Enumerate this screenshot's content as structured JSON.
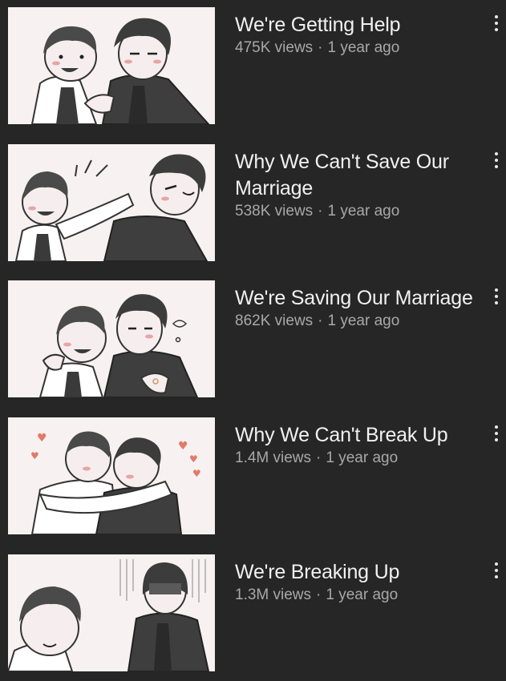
{
  "videos": [
    {
      "title": "We're Getting Help",
      "views": "475K views",
      "age": "1 year ago",
      "thumbnail_icon": "thumbnail-illustration"
    },
    {
      "title": "Why We Can't Save Our Marriage",
      "views": "538K views",
      "age": "1 year ago",
      "thumbnail_icon": "thumbnail-illustration"
    },
    {
      "title": "We're Saving Our Marriage",
      "views": "862K views",
      "age": "1 year ago",
      "thumbnail_icon": "thumbnail-illustration"
    },
    {
      "title": "Why We Can't Break Up",
      "views": "1.4M views",
      "age": "1 year ago",
      "thumbnail_icon": "thumbnail-illustration"
    },
    {
      "title": "We're Breaking Up",
      "views": "1.3M views",
      "age": "1 year ago",
      "thumbnail_icon": "thumbnail-illustration"
    }
  ],
  "meta_separator": "·",
  "colors": {
    "background": "#262626",
    "title_text": "#f1f1f1",
    "meta_text": "#a8a8a8",
    "thumbnail_bg": "#f8f1f1"
  }
}
